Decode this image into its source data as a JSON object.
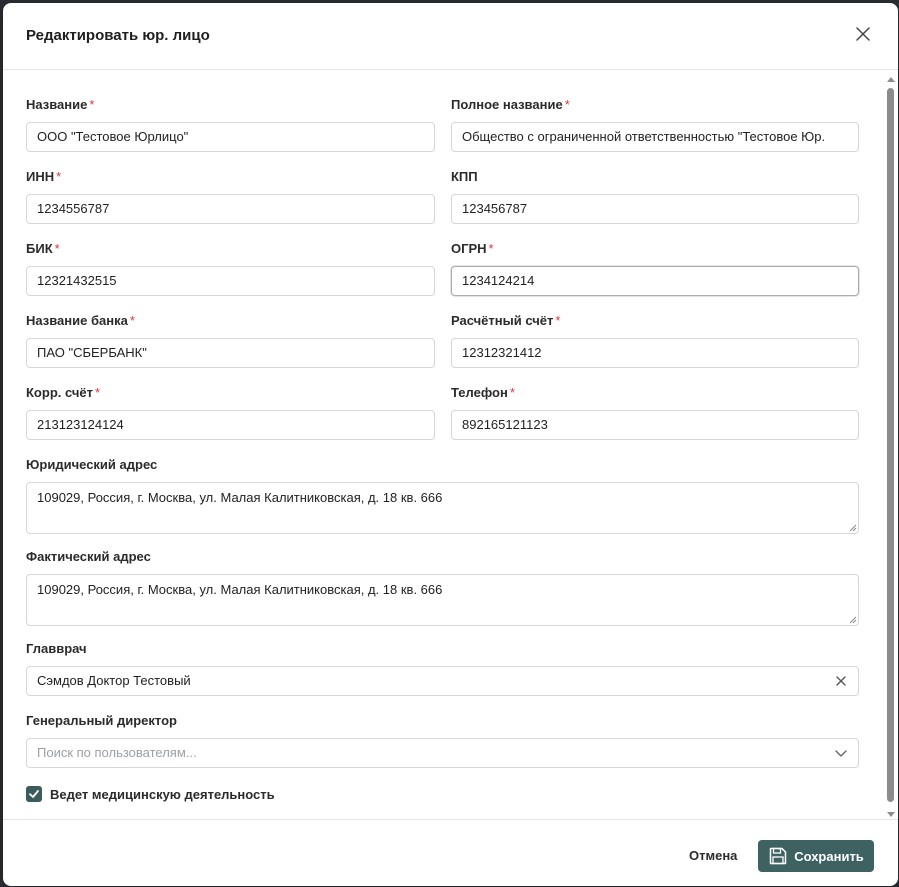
{
  "dialog": {
    "title": "Редактировать юр. лицо"
  },
  "form": {
    "name": {
      "label": "Название",
      "required": "*",
      "value": "ООО \"Тестовое Юрлицо\""
    },
    "full_name": {
      "label": "Полное название",
      "required": "*",
      "value": "Общество с ограниченной ответственностью \"Тестовое Юр."
    },
    "inn": {
      "label": "ИНН",
      "required": "*",
      "value": "1234556787"
    },
    "kpp": {
      "label": "КПП",
      "value": "123456787"
    },
    "bik": {
      "label": "БИК",
      "required": "*",
      "value": "12321432515"
    },
    "ogrn": {
      "label": "ОГРН",
      "required": "*",
      "value": "1234124214"
    },
    "bank_name": {
      "label": "Название банка",
      "required": "*",
      "value": "ПАО \"СБЕРБАНК\""
    },
    "account": {
      "label": "Расчётный счёт",
      "required": "*",
      "value": "12312321412"
    },
    "corr_account": {
      "label": "Корр. счёт",
      "required": "*",
      "value": "213123124124"
    },
    "phone": {
      "label": "Телефон",
      "required": "*",
      "value": "892165121123"
    },
    "legal_address": {
      "label": "Юридический адрес",
      "value": "109029, Россия, г. Москва, ул. Малая Калитниковская, д. 18 кв. 666"
    },
    "actual_address": {
      "label": "Фактический адрес",
      "value": "109029, Россия, г. Москва, ул. Малая Калитниковская, д. 18 кв. 666"
    },
    "chief_doctor": {
      "label": "Главврач",
      "value": "Сэмдов Доктор Тестовый"
    },
    "general_director": {
      "label": "Генеральный директор",
      "placeholder": "Поиск по пользователям..."
    },
    "medical_activity": {
      "label": "Ведет медицинскую деятельность",
      "checked": true
    }
  },
  "footer": {
    "cancel_label": "Отмена",
    "save_label": "Сохранить"
  },
  "colors": {
    "primary": "#3e6262",
    "required": "#d9363e",
    "checkbox": "#3a5c5c"
  },
  "icons": {
    "close": "close-icon",
    "clear": "clear-icon",
    "chevron": "chevron-down-icon",
    "save": "floppy-disk-icon",
    "check": "check-icon"
  }
}
